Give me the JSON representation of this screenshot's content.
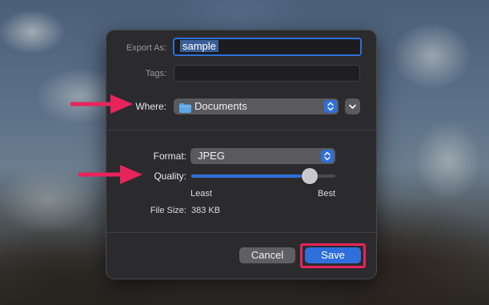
{
  "dialog": {
    "export_as_label": "Export As:",
    "export_as_value": "sample",
    "tags_label": "Tags:",
    "tags_value": "",
    "where_label": "Where:",
    "where_value": "Documents",
    "format_label": "Format:",
    "format_value": "JPEG",
    "quality_label": "Quality:",
    "quality_level": 0.82,
    "quality_min_label": "Least",
    "quality_max_label": "Best",
    "filesize_label": "File Size:",
    "filesize_value": "383 KB",
    "cancel_label": "Cancel",
    "save_label": "Save"
  },
  "colors": {
    "accent": "#2f6fdb",
    "annotation": "#e8245c",
    "folder": "#5aa9e6"
  },
  "icons": [
    "folder-icon",
    "popup-stepper-icon",
    "chevron-down-icon",
    "arrow-annotation-icon"
  ]
}
